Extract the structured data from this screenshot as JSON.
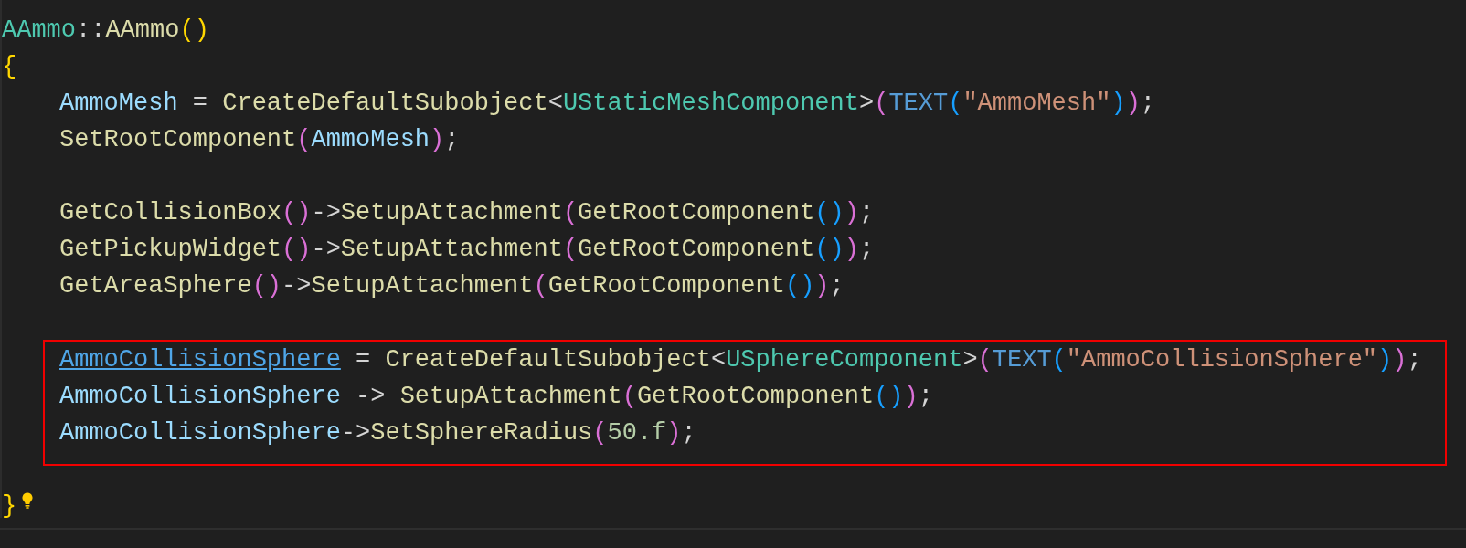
{
  "editor": {
    "lines": [
      {
        "kind": "line",
        "indented": false,
        "tokens": [
          {
            "kind": "type",
            "text": "AAmmo"
          },
          {
            "kind": "punct",
            "text": "::"
          },
          {
            "kind": "func",
            "text": "AAmmo"
          },
          {
            "kind": "bracket1",
            "text": "()"
          }
        ]
      },
      {
        "kind": "line",
        "indented": false,
        "tokens": [
          {
            "kind": "bracket1",
            "text": "{"
          }
        ]
      },
      {
        "kind": "line",
        "indented": true,
        "tokens": [
          {
            "kind": "var",
            "text": "AmmoMesh"
          },
          {
            "kind": "punct",
            "text": " = "
          },
          {
            "kind": "func",
            "text": "CreateDefaultSubobject"
          },
          {
            "kind": "punct",
            "text": "<"
          },
          {
            "kind": "type",
            "text": "UStaticMeshComponent"
          },
          {
            "kind": "punct",
            "text": ">"
          },
          {
            "kind": "bracket2",
            "text": "("
          },
          {
            "kind": "macro",
            "text": "TEXT"
          },
          {
            "kind": "bracket3",
            "text": "("
          },
          {
            "kind": "string",
            "text": "\"AmmoMesh\""
          },
          {
            "kind": "bracket3",
            "text": ")"
          },
          {
            "kind": "bracket2",
            "text": ")"
          },
          {
            "kind": "punct",
            "text": ";"
          }
        ]
      },
      {
        "kind": "line",
        "indented": true,
        "tokens": [
          {
            "kind": "func",
            "text": "SetRootComponent"
          },
          {
            "kind": "bracket2",
            "text": "("
          },
          {
            "kind": "var",
            "text": "AmmoMesh"
          },
          {
            "kind": "bracket2",
            "text": ")"
          },
          {
            "kind": "punct",
            "text": ";"
          }
        ]
      },
      {
        "kind": "blank"
      },
      {
        "kind": "line",
        "indented": true,
        "tokens": [
          {
            "kind": "func",
            "text": "GetCollisionBox"
          },
          {
            "kind": "bracket2",
            "text": "()"
          },
          {
            "kind": "punct",
            "text": "->"
          },
          {
            "kind": "func",
            "text": "SetupAttachment"
          },
          {
            "kind": "bracket2",
            "text": "("
          },
          {
            "kind": "func",
            "text": "GetRootComponent"
          },
          {
            "kind": "bracket3",
            "text": "()"
          },
          {
            "kind": "bracket2",
            "text": ")"
          },
          {
            "kind": "punct",
            "text": ";"
          }
        ]
      },
      {
        "kind": "line",
        "indented": true,
        "tokens": [
          {
            "kind": "func",
            "text": "GetPickupWidget"
          },
          {
            "kind": "bracket2",
            "text": "()"
          },
          {
            "kind": "punct",
            "text": "->"
          },
          {
            "kind": "func",
            "text": "SetupAttachment"
          },
          {
            "kind": "bracket2",
            "text": "("
          },
          {
            "kind": "func",
            "text": "GetRootComponent"
          },
          {
            "kind": "bracket3",
            "text": "()"
          },
          {
            "kind": "bracket2",
            "text": ")"
          },
          {
            "kind": "punct",
            "text": ";"
          }
        ]
      },
      {
        "kind": "line",
        "indented": true,
        "tokens": [
          {
            "kind": "func",
            "text": "GetAreaSphere"
          },
          {
            "kind": "bracket2",
            "text": "()"
          },
          {
            "kind": "punct",
            "text": "->"
          },
          {
            "kind": "func",
            "text": "SetupAttachment"
          },
          {
            "kind": "bracket2",
            "text": "("
          },
          {
            "kind": "func",
            "text": "GetRootComponent"
          },
          {
            "kind": "bracket3",
            "text": "()"
          },
          {
            "kind": "bracket2",
            "text": ")"
          },
          {
            "kind": "punct",
            "text": ";"
          }
        ]
      },
      {
        "kind": "blank"
      },
      {
        "kind": "highlight",
        "lines": [
          {
            "kind": "line",
            "tokens": [
              {
                "kind": "link",
                "text": "AmmoCollisionSphere"
              },
              {
                "kind": "punct",
                "text": " = "
              },
              {
                "kind": "func",
                "text": "CreateDefaultSubobject"
              },
              {
                "kind": "punct",
                "text": "<"
              },
              {
                "kind": "type",
                "text": "USphereComponent"
              },
              {
                "kind": "punct",
                "text": ">"
              },
              {
                "kind": "bracket2",
                "text": "("
              },
              {
                "kind": "macro",
                "text": "TEXT"
              },
              {
                "kind": "bracket3",
                "text": "("
              },
              {
                "kind": "string",
                "text": "\"AmmoCollisionSphere\""
              },
              {
                "kind": "bracket3",
                "text": ")"
              },
              {
                "kind": "bracket2",
                "text": ")"
              },
              {
                "kind": "punct",
                "text": ";"
              }
            ]
          },
          {
            "kind": "line",
            "tokens": [
              {
                "kind": "var",
                "text": "AmmoCollisionSphere"
              },
              {
                "kind": "punct",
                "text": " -> "
              },
              {
                "kind": "func",
                "text": "SetupAttachment"
              },
              {
                "kind": "bracket2",
                "text": "("
              },
              {
                "kind": "func",
                "text": "GetRootComponent"
              },
              {
                "kind": "bracket3",
                "text": "()"
              },
              {
                "kind": "bracket2",
                "text": ")"
              },
              {
                "kind": "punct",
                "text": ";"
              }
            ]
          },
          {
            "kind": "line",
            "tokens": [
              {
                "kind": "var",
                "text": "AmmoCollisionSphere"
              },
              {
                "kind": "punct",
                "text": "->"
              },
              {
                "kind": "func",
                "text": "SetSphereRadius"
              },
              {
                "kind": "bracket2",
                "text": "("
              },
              {
                "kind": "number",
                "text": "50.f"
              },
              {
                "kind": "bracket2",
                "text": ")"
              },
              {
                "kind": "punct",
                "text": ";"
              }
            ]
          }
        ]
      },
      {
        "kind": "blank"
      },
      {
        "kind": "line",
        "indented": false,
        "lightbulb": true,
        "tokens": [
          {
            "kind": "bracket1",
            "text": "}"
          }
        ]
      }
    ]
  }
}
